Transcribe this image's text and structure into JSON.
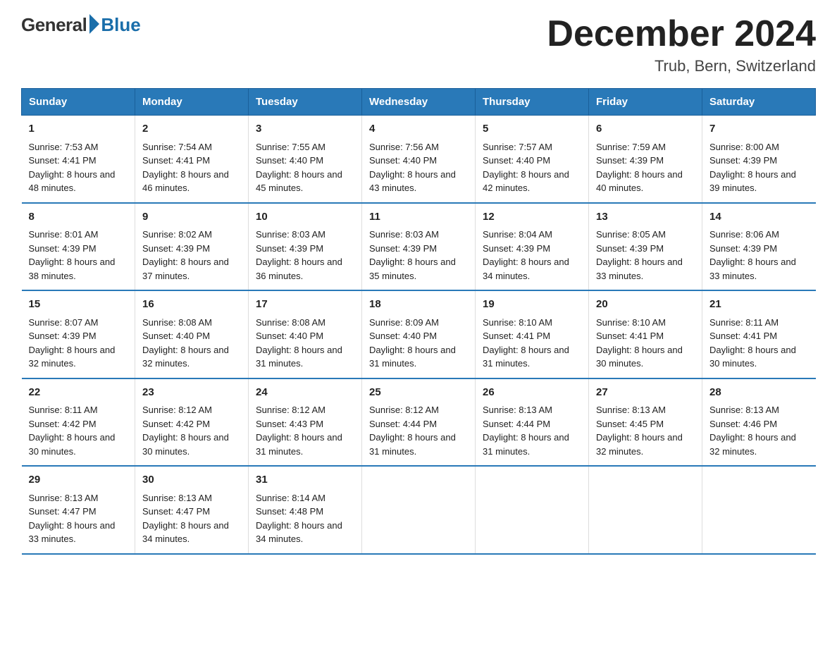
{
  "header": {
    "logo_general": "General",
    "logo_blue": "Blue",
    "title": "December 2024",
    "location": "Trub, Bern, Switzerland"
  },
  "days_of_week": [
    "Sunday",
    "Monday",
    "Tuesday",
    "Wednesday",
    "Thursday",
    "Friday",
    "Saturday"
  ],
  "weeks": [
    [
      {
        "day": "1",
        "sunrise": "7:53 AM",
        "sunset": "4:41 PM",
        "daylight": "8 hours and 48 minutes."
      },
      {
        "day": "2",
        "sunrise": "7:54 AM",
        "sunset": "4:41 PM",
        "daylight": "8 hours and 46 minutes."
      },
      {
        "day": "3",
        "sunrise": "7:55 AM",
        "sunset": "4:40 PM",
        "daylight": "8 hours and 45 minutes."
      },
      {
        "day": "4",
        "sunrise": "7:56 AM",
        "sunset": "4:40 PM",
        "daylight": "8 hours and 43 minutes."
      },
      {
        "day": "5",
        "sunrise": "7:57 AM",
        "sunset": "4:40 PM",
        "daylight": "8 hours and 42 minutes."
      },
      {
        "day": "6",
        "sunrise": "7:59 AM",
        "sunset": "4:39 PM",
        "daylight": "8 hours and 40 minutes."
      },
      {
        "day": "7",
        "sunrise": "8:00 AM",
        "sunset": "4:39 PM",
        "daylight": "8 hours and 39 minutes."
      }
    ],
    [
      {
        "day": "8",
        "sunrise": "8:01 AM",
        "sunset": "4:39 PM",
        "daylight": "8 hours and 38 minutes."
      },
      {
        "day": "9",
        "sunrise": "8:02 AM",
        "sunset": "4:39 PM",
        "daylight": "8 hours and 37 minutes."
      },
      {
        "day": "10",
        "sunrise": "8:03 AM",
        "sunset": "4:39 PM",
        "daylight": "8 hours and 36 minutes."
      },
      {
        "day": "11",
        "sunrise": "8:03 AM",
        "sunset": "4:39 PM",
        "daylight": "8 hours and 35 minutes."
      },
      {
        "day": "12",
        "sunrise": "8:04 AM",
        "sunset": "4:39 PM",
        "daylight": "8 hours and 34 minutes."
      },
      {
        "day": "13",
        "sunrise": "8:05 AM",
        "sunset": "4:39 PM",
        "daylight": "8 hours and 33 minutes."
      },
      {
        "day": "14",
        "sunrise": "8:06 AM",
        "sunset": "4:39 PM",
        "daylight": "8 hours and 33 minutes."
      }
    ],
    [
      {
        "day": "15",
        "sunrise": "8:07 AM",
        "sunset": "4:39 PM",
        "daylight": "8 hours and 32 minutes."
      },
      {
        "day": "16",
        "sunrise": "8:08 AM",
        "sunset": "4:40 PM",
        "daylight": "8 hours and 32 minutes."
      },
      {
        "day": "17",
        "sunrise": "8:08 AM",
        "sunset": "4:40 PM",
        "daylight": "8 hours and 31 minutes."
      },
      {
        "day": "18",
        "sunrise": "8:09 AM",
        "sunset": "4:40 PM",
        "daylight": "8 hours and 31 minutes."
      },
      {
        "day": "19",
        "sunrise": "8:10 AM",
        "sunset": "4:41 PM",
        "daylight": "8 hours and 31 minutes."
      },
      {
        "day": "20",
        "sunrise": "8:10 AM",
        "sunset": "4:41 PM",
        "daylight": "8 hours and 30 minutes."
      },
      {
        "day": "21",
        "sunrise": "8:11 AM",
        "sunset": "4:41 PM",
        "daylight": "8 hours and 30 minutes."
      }
    ],
    [
      {
        "day": "22",
        "sunrise": "8:11 AM",
        "sunset": "4:42 PM",
        "daylight": "8 hours and 30 minutes."
      },
      {
        "day": "23",
        "sunrise": "8:12 AM",
        "sunset": "4:42 PM",
        "daylight": "8 hours and 30 minutes."
      },
      {
        "day": "24",
        "sunrise": "8:12 AM",
        "sunset": "4:43 PM",
        "daylight": "8 hours and 31 minutes."
      },
      {
        "day": "25",
        "sunrise": "8:12 AM",
        "sunset": "4:44 PM",
        "daylight": "8 hours and 31 minutes."
      },
      {
        "day": "26",
        "sunrise": "8:13 AM",
        "sunset": "4:44 PM",
        "daylight": "8 hours and 31 minutes."
      },
      {
        "day": "27",
        "sunrise": "8:13 AM",
        "sunset": "4:45 PM",
        "daylight": "8 hours and 32 minutes."
      },
      {
        "day": "28",
        "sunrise": "8:13 AM",
        "sunset": "4:46 PM",
        "daylight": "8 hours and 32 minutes."
      }
    ],
    [
      {
        "day": "29",
        "sunrise": "8:13 AM",
        "sunset": "4:47 PM",
        "daylight": "8 hours and 33 minutes."
      },
      {
        "day": "30",
        "sunrise": "8:13 AM",
        "sunset": "4:47 PM",
        "daylight": "8 hours and 34 minutes."
      },
      {
        "day": "31",
        "sunrise": "8:14 AM",
        "sunset": "4:48 PM",
        "daylight": "8 hours and 34 minutes."
      },
      null,
      null,
      null,
      null
    ]
  ],
  "labels": {
    "sunrise": "Sunrise:",
    "sunset": "Sunset:",
    "daylight": "Daylight:"
  }
}
